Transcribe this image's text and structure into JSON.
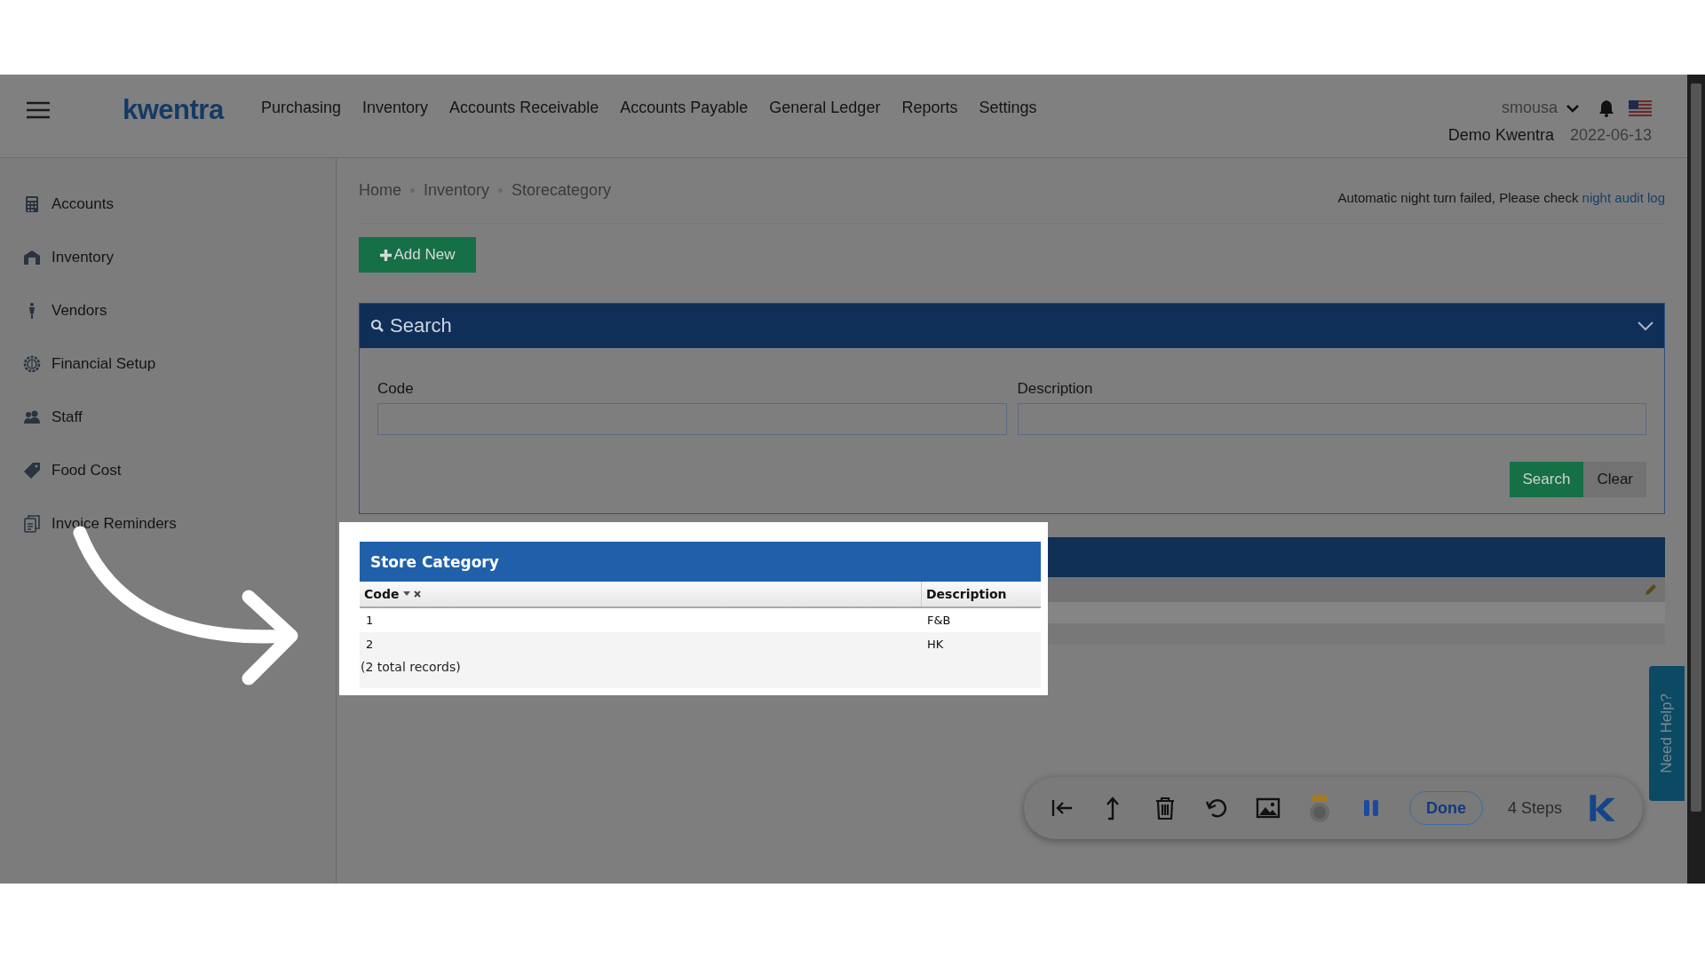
{
  "header": {
    "logo": "kwentra",
    "nav": [
      "Purchasing",
      "Inventory",
      "Accounts Receivable",
      "Accounts Payable",
      "General Ledger",
      "Reports",
      "Settings"
    ],
    "user": "smousa",
    "company": "Demo Kwentra",
    "date": "2022-06-13"
  },
  "sidebar": {
    "items": [
      {
        "label": "Accounts"
      },
      {
        "label": "Inventory"
      },
      {
        "label": "Vendors"
      },
      {
        "label": "Financial Setup"
      },
      {
        "label": "Staff"
      },
      {
        "label": "Food Cost"
      },
      {
        "label": "Invoice Reminders"
      }
    ]
  },
  "breadcrumb": [
    "Home",
    "Inventory",
    "Storecategory"
  ],
  "notice": {
    "text": "Automatic night turn failed, Please check",
    "link": "night audit log"
  },
  "add_button": "Add New",
  "search_panel": {
    "title": "Search",
    "fields": [
      {
        "label": "Code"
      },
      {
        "label": "Description"
      }
    ],
    "buttons": [
      "Search",
      "Clear"
    ]
  },
  "grid": {
    "title": "Store Category",
    "columns": [
      {
        "label": "Code",
        "sorted": true
      },
      {
        "label": "Description",
        "sorted": false
      }
    ],
    "rows": [
      {
        "code": "1",
        "description": "F&B"
      },
      {
        "code": "2",
        "description": "HK"
      }
    ],
    "total": "(2 total records)"
  },
  "recorder": {
    "done": "Done",
    "steps": "4 Steps"
  },
  "help_tab": "Need Help?"
}
